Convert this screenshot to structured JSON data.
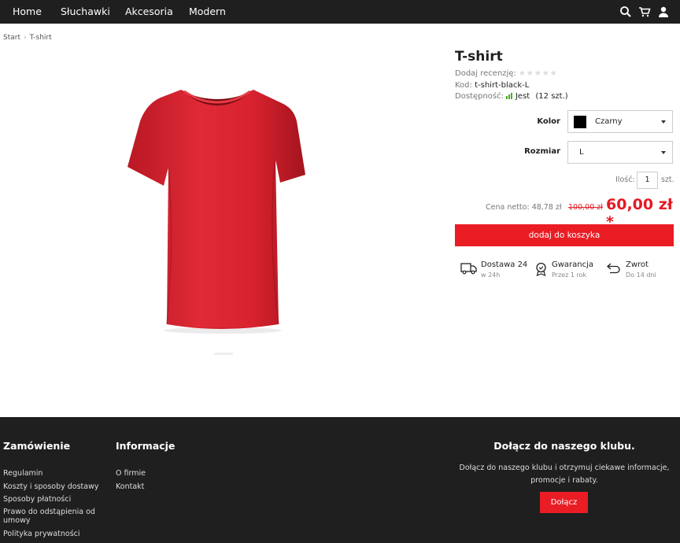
{
  "nav": {
    "items": [
      {
        "label": "Home"
      },
      {
        "label": "Słuchawki"
      },
      {
        "label": "Akcesoria"
      },
      {
        "label": "Modern"
      }
    ],
    "icons": [
      "search-icon",
      "cart-icon",
      "user-icon"
    ]
  },
  "breadcrumb": [
    "Start",
    "T-shirt"
  ],
  "product": {
    "title": "T-shirt",
    "review_label": "Dodaj recenzję:",
    "rating_stars": 5,
    "rating_value": 0,
    "code_label": "Kod:",
    "code": "t-shirt-black-L",
    "availability_label": "Dostępność:",
    "availability": "Jest",
    "stock": "(12 szt.)",
    "color_label": "Kolor",
    "color_value": "Czarny",
    "color_swatch": "#000000",
    "size_label": "Rozmiar",
    "size_value": "L",
    "qty_label": "Ilość:",
    "qty_value": "1",
    "qty_unit": "szt.",
    "net_price": "Cena netto: 48,78 zł",
    "old_price": "100,00 zł",
    "price": "60,00 zł *",
    "add_to_cart": "dodaj do koszyka",
    "image_color": "#d8222f"
  },
  "features": [
    {
      "title": "Dostawa 24",
      "subtitle": "w 24h",
      "icon": "truck-icon"
    },
    {
      "title": "Gwarancja",
      "subtitle": "Przez 1 rok",
      "icon": "badge-icon"
    },
    {
      "title": "Zwrot",
      "subtitle": "Do 14 dni",
      "icon": "return-icon"
    }
  ],
  "footer": {
    "order": {
      "heading": "Zamówienie",
      "links": [
        "Regulamin",
        "Koszty i sposoby dostawy",
        "Sposoby płatności",
        "Prawo do odstąpienia od umowy",
        "Polityka prywatności"
      ]
    },
    "info": {
      "heading": "Informacje",
      "links": [
        "O firmie",
        "Kontakt"
      ]
    },
    "club": {
      "heading": "Dołącz do naszego klubu.",
      "description": "Dołącz do naszego klubu i otrzymuj ciekawe informacje, promocje i rabaty.",
      "button": "Dołącz"
    }
  },
  "colors": {
    "accent": "#ea1c24",
    "dark": "#1f1f1f",
    "availability": "#4cae1f"
  }
}
